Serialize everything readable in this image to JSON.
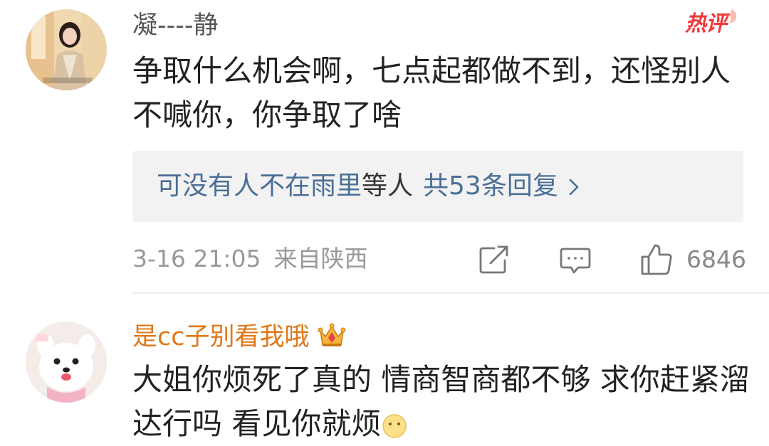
{
  "comment1": {
    "username": "凝----静",
    "hot_label": "热评",
    "text": "争取什么机会啊，七点起都做不到，还怪别人不喊你，你争取了啥",
    "replies": {
      "user": "可没有人不在雨里",
      "suffix": "等人",
      "count": "共53条回复"
    },
    "timestamp": "3-16 21:05",
    "source": "来自陕西",
    "like_count": "6846"
  },
  "comment2": {
    "username": "是cc子别看我哦",
    "text": "大姐你烦死了真的 情商智商都不够 求你赶紧溜达行吗 看见你就烦"
  },
  "icons": {
    "repost": "repost-icon",
    "comment": "comment-icon",
    "like": "thumbs-up-icon",
    "reply_arrow": "chevron-right-icon",
    "vip": "crown-icon",
    "hot": "flame-icon"
  },
  "colors": {
    "hot_badge": "#f03a3a",
    "vip_username": "#e07818",
    "reply_link": "#4a6f96"
  }
}
